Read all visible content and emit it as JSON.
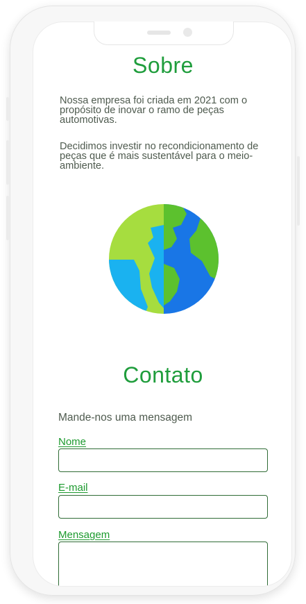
{
  "sobre": {
    "title": "Sobre",
    "paragraphs": [
      "Nossa empresa foi criada em 2021 com o propósito de inovar o ramo de peças automotivas.",
      "Decidimos investir no recondicionamento de peças que é mais sustentável para o meio-ambiente."
    ],
    "illustration": "globe-icon"
  },
  "contato": {
    "title": "Contato",
    "lead": "Mande-nos uma mensagem",
    "fields": {
      "name_label": "Nome",
      "name_value": "",
      "email_label": "E-mail",
      "email_value": "",
      "message_label": "Mensagem",
      "message_value": ""
    }
  },
  "colors": {
    "accent": "#1f9d3c",
    "text": "#4e5a4e",
    "field_border": "#2f6b35",
    "globe_land_light": "#a6dd3f",
    "globe_land_dark": "#5cc12e",
    "globe_ocean_light": "#1ab2f0",
    "globe_ocean_dark": "#1976e6"
  }
}
